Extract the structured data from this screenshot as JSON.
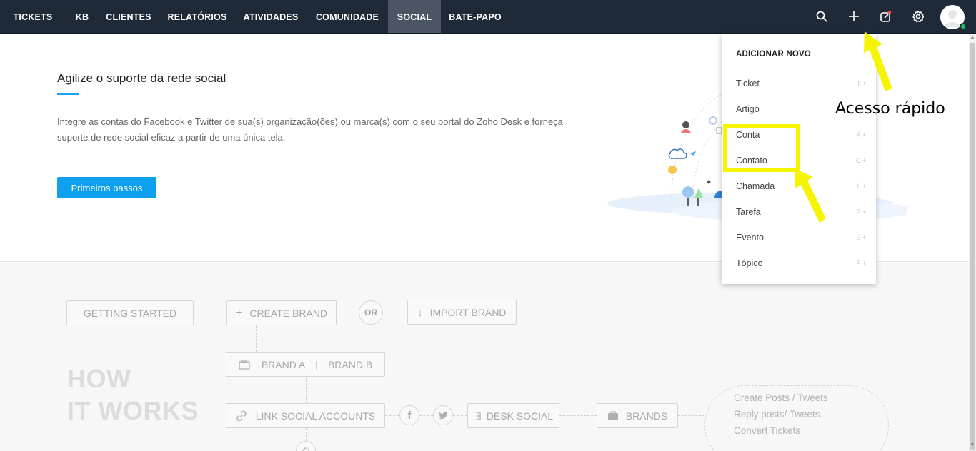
{
  "nav": {
    "items": [
      {
        "label": "TICKETS",
        "active": false
      },
      {
        "label": "KB",
        "active": false
      },
      {
        "label": "CLIENTES",
        "active": false
      },
      {
        "label": "RELATÓRIOS",
        "active": false
      },
      {
        "label": "ATIVIDADES",
        "active": false
      },
      {
        "label": "COMUNIDADE",
        "active": false
      },
      {
        "label": "SOCIAL",
        "active": true
      },
      {
        "label": "BATE-PAPO",
        "active": false
      }
    ],
    "icons": [
      "search-icon",
      "plus-icon",
      "compose-icon",
      "gear-icon"
    ],
    "bg_color": "#1f2a38",
    "status_color": "#20c05c"
  },
  "hero": {
    "title": "Agilize o suporte da rede social",
    "description": "Integre as contas do Facebook e Twitter de sua(s) organização(ões) ou marca(s) com o seu portal do Zoho Desk e forneça suporte de rede social eficaz a partir de uma única tela.",
    "button_label": "Primeiros passos",
    "accent_color": "#0ea0ee"
  },
  "diagram": {
    "getting_started": "GETTING STARTED",
    "create_brand": "CREATE BRAND",
    "or": "OR",
    "import_brand": "IMPORT BRAND",
    "brand_a": "BRAND A",
    "separator": "|",
    "brand_b": "BRAND B",
    "how_line1": "HOW",
    "how_line2": "IT WORKS",
    "link_social": "LINK SOCIAL ACCOUNTS",
    "desk_social": "DESK SOCIAL",
    "brands": "BRANDS",
    "actions": [
      "Create Posts / Tweets",
      "Reply posts/ Tweets",
      "Convert Tickets"
    ]
  },
  "dropdown": {
    "header": "ADICIONAR NOVO",
    "items": [
      {
        "label": "Ticket",
        "key": "T +"
      },
      {
        "label": "Artigo",
        "key": ""
      },
      {
        "label": "Conta",
        "key": "A +"
      },
      {
        "label": "Contato",
        "key": "C +"
      },
      {
        "label": "Chamada",
        "key": "L +"
      },
      {
        "label": "Tarefa",
        "key": "P +"
      },
      {
        "label": "Evento",
        "key": "E +"
      },
      {
        "label": "Tópico",
        "key": "F +"
      }
    ]
  },
  "annotation": {
    "text": "Acesso rápido",
    "color": "#f5f500"
  }
}
